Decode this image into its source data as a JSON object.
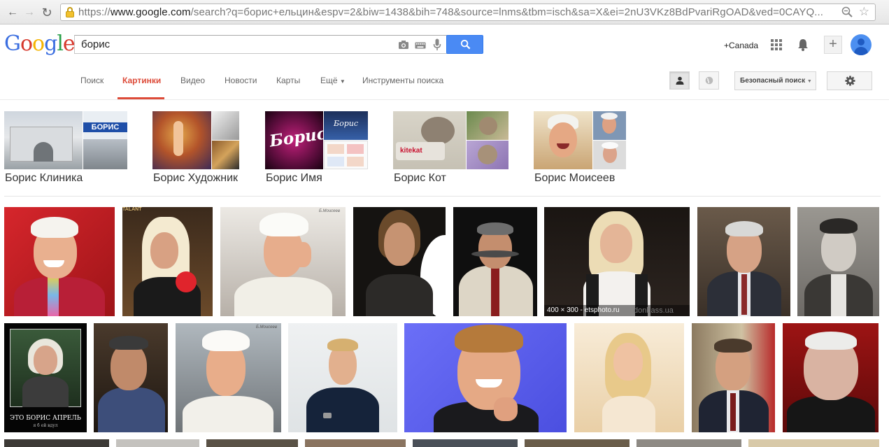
{
  "browser": {
    "url_prefix": "https://",
    "url_host": "www.google.com",
    "url_path": "/search?q=борис+ельцин&espv=2&biw=1438&bih=748&source=lnms&tbm=isch&sa=X&ei=2nU3VKz8BdPvariRgOAD&ved=0CAYQ..."
  },
  "header": {
    "logo_letters": [
      "G",
      "o",
      "o",
      "g",
      "l",
      "e"
    ],
    "query": "борис",
    "plus_name": "+Canada"
  },
  "tabs": [
    {
      "label": "Поиск"
    },
    {
      "label": "Картинки"
    },
    {
      "label": "Видео"
    },
    {
      "label": "Новости"
    },
    {
      "label": "Карты"
    },
    {
      "label": "Ещё"
    },
    {
      "label": "Инструменты поиска"
    }
  ],
  "toolbar": {
    "safe_search_label": "Безопасный поиск"
  },
  "related": [
    {
      "label": "Борис Клиника"
    },
    {
      "label": "Борис Художник"
    },
    {
      "label": "Борис Имя"
    },
    {
      "label": "Борис Кот"
    },
    {
      "label": "Борис Моисеев"
    }
  ],
  "related_texts": {
    "klinika_sign": "БОРИС",
    "imya_logo": "Борис",
    "imya_small": "Борис",
    "kot_brand": "kitekat"
  },
  "results": {
    "hover_caption": "400 × 300 - etsphoto.ru",
    "hover_watermark": "donbass.ua",
    "moiseev_watermark": "Б.Моисеев",
    "talant_top": "TALANT",
    "demot_main": "ЭТО БОРИС АПРЕЛЬ",
    "demot_sub": "я б ей вдул"
  },
  "colors": {
    "accent_red": "#dd4b39",
    "search_blue": "#4a8af4"
  }
}
